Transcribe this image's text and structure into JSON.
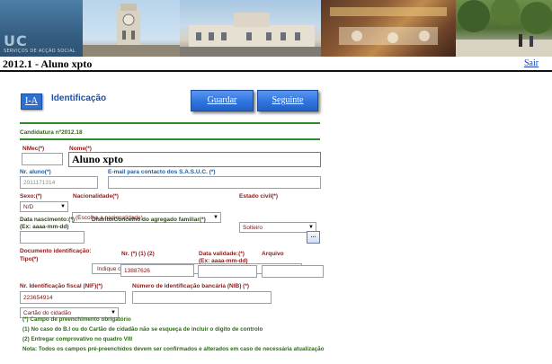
{
  "banner": {
    "logo_text": "UC",
    "logo_subtext": "SERVIÇOS DE ACÇÃO SOCIAL"
  },
  "header": {
    "title": "2012.1 - Aluno xpto",
    "logout_label": "Sair"
  },
  "form": {
    "page_button": "I-A",
    "section_title": "Identificação",
    "save_label": "Guardar",
    "next_label": "Seguinte",
    "candidatura": "Candidatura nº2012.18",
    "fields": {
      "nmec": {
        "label": "NMec(*)",
        "value": ""
      },
      "nome": {
        "label": "Nome(*)",
        "value": "Aluno xpto"
      },
      "nr_aluno": {
        "label": "Nr. aluno(*)",
        "value": "2011171314"
      },
      "email": {
        "label": "E-mail para contacto dos S.A.S.U.C. (*)",
        "value": ""
      },
      "sexo": {
        "label": "Sexo:(*)",
        "value": "N/D"
      },
      "nacionalidade": {
        "label": "Nacionalidade(*)",
        "value": "(Escolha a nacionalidade)"
      },
      "estado_civil": {
        "label": "Estado civil(*)",
        "value": "Solteiro"
      },
      "data_nascimento": {
        "label": "Data nascimento:(*)",
        "sublabel": "(Ex: aaaa-mm-dd)",
        "value": ""
      },
      "distrito": {
        "label": "Distrito/Concelho do agregado familiar(*)",
        "value": "Indique o Distrito/Concelho",
        "button": "..."
      },
      "doc_tipo": {
        "label": "Documento identificação:",
        "sublabel": "Tipo(*)",
        "value": "Cartão do cidadão"
      },
      "doc_nr": {
        "label": "Nr. (*) (1) (2)",
        "value": "13887626"
      },
      "data_validade": {
        "label": "Data validade:(*)",
        "sublabel": "(Ex: aaaa-mm-dd)",
        "value": ""
      },
      "arquivo": {
        "label": "Arquivo",
        "value": ""
      },
      "nif": {
        "label": "Nr. Identificação fiscal (NIF)(*)",
        "value": "223654914"
      },
      "nib": {
        "label": "Número de identificação bancária (NIB) (*)",
        "value": ""
      }
    },
    "notes": [
      "(*) Campo de preenchimento obrigatório",
      "(1) No caso do B.I ou do Cartão de cidadão não se esqueça de incluir o digito de controlo",
      "(2) Entregar comprovativo no quadro VIII",
      "Nota: Todos os campos pré-preenchidos devem ser confirmados e alterados em caso de necessária atualização"
    ]
  },
  "colors": {
    "accent_blue": "#2f74de",
    "rule_green": "#2d8a2d",
    "label_blue": "#1e5a9c",
    "value_red": "#7a1515"
  },
  "icons": {
    "dropdown": "chevron-down-icon",
    "browse": "ellipsis-icon"
  }
}
